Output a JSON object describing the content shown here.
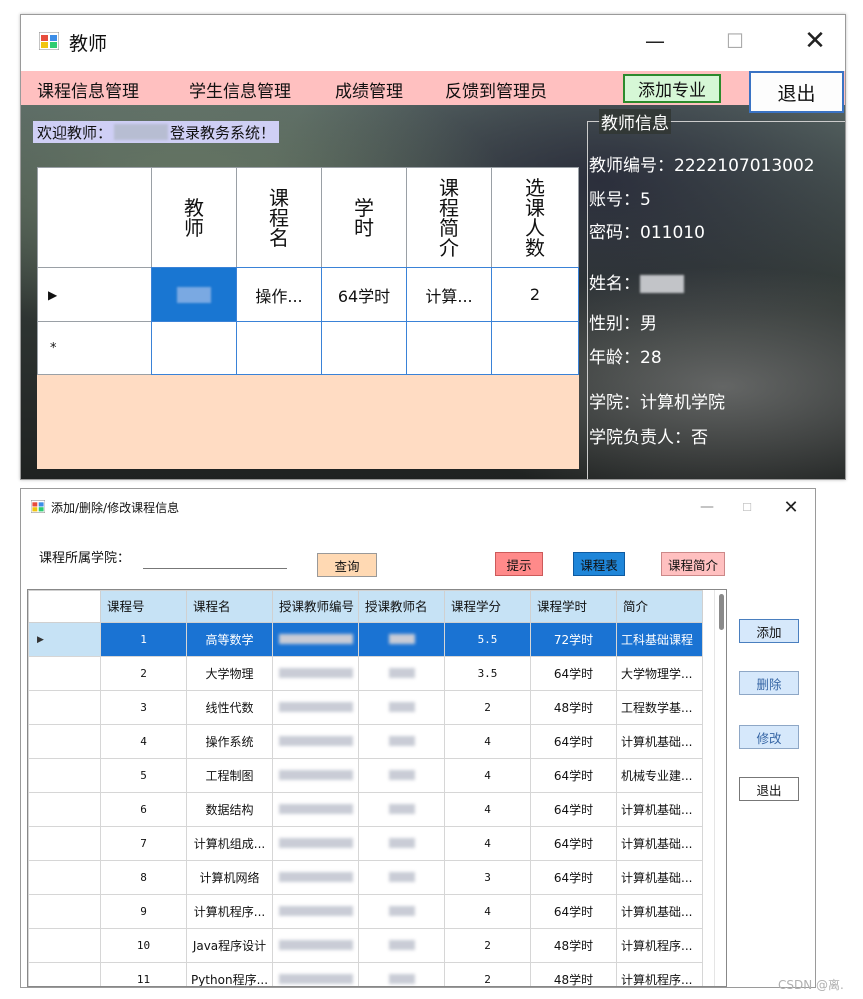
{
  "teacher_window": {
    "title": "教师",
    "menu": [
      "课程信息管理",
      "学生信息管理",
      "成绩管理",
      "反馈到管理员"
    ],
    "add_major_label": "添加专业",
    "exit_label": "退出",
    "welcome_prefix": "欢迎教师：",
    "welcome_suffix": "登录教务系统！",
    "grid": {
      "headers": [
        "教师",
        "课程名",
        "学时",
        "课程简介",
        "选课人数"
      ],
      "row": {
        "course": "操作...",
        "hours": "64学时",
        "intro": "计算...",
        "count": "2"
      },
      "new_row_marker": "*",
      "current_row_marker": "▶"
    },
    "info": {
      "group_title": "教师信息",
      "teacher_id": "教师编号：2222107013002",
      "account": "账号：5",
      "password": "密码：011010",
      "name_label": "姓名：",
      "gender": "性别：男",
      "age": "年龄：28",
      "college": "学院：计算机学院",
      "is_head": "学院负责人：否"
    }
  },
  "course_window": {
    "title": "添加/删除/修改课程信息",
    "college_label": "课程所属学院：",
    "college_value": "",
    "buttons": {
      "query": "查询",
      "tip": "提示",
      "table": "课程表",
      "intro": "课程简介",
      "add": "添加",
      "delete": "删除",
      "modify": "修改",
      "exit": "退出"
    },
    "columns": [
      "课程号",
      "课程名",
      "授课教师编号",
      "授课教师名",
      "课程学分",
      "课程学时",
      "简介"
    ],
    "rows": [
      {
        "id": "1",
        "name": "高等数学",
        "credit": "5.5",
        "hours": "72学时",
        "intro": "工科基础课程"
      },
      {
        "id": "2",
        "name": "大学物理",
        "credit": "3.5",
        "hours": "64学时",
        "intro": "大学物理学..."
      },
      {
        "id": "3",
        "name": "线性代数",
        "credit": "2",
        "hours": "48学时",
        "intro": "工程数学基..."
      },
      {
        "id": "4",
        "name": "操作系统",
        "credit": "4",
        "hours": "64学时",
        "intro": "计算机基础..."
      },
      {
        "id": "5",
        "name": "工程制图",
        "credit": "4",
        "hours": "64学时",
        "intro": "机械专业建..."
      },
      {
        "id": "6",
        "name": "数据结构",
        "credit": "4",
        "hours": "64学时",
        "intro": "计算机基础..."
      },
      {
        "id": "7",
        "name": "计算机组成...",
        "credit": "4",
        "hours": "64学时",
        "intro": "计算机基础..."
      },
      {
        "id": "8",
        "name": "计算机网络",
        "credit": "3",
        "hours": "64学时",
        "intro": "计算机基础..."
      },
      {
        "id": "9",
        "name": "计算机程序...",
        "credit": "4",
        "hours": "64学时",
        "intro": "计算机基础..."
      },
      {
        "id": "10",
        "name": "Java程序设计",
        "credit": "2",
        "hours": "48学时",
        "intro": "计算机程序..."
      },
      {
        "id": "11",
        "name": "Python程序...",
        "credit": "2",
        "hours": "48学时",
        "intro": "计算机程序..."
      }
    ],
    "current_row_marker": "▶"
  },
  "watermark": "CSDN @离."
}
